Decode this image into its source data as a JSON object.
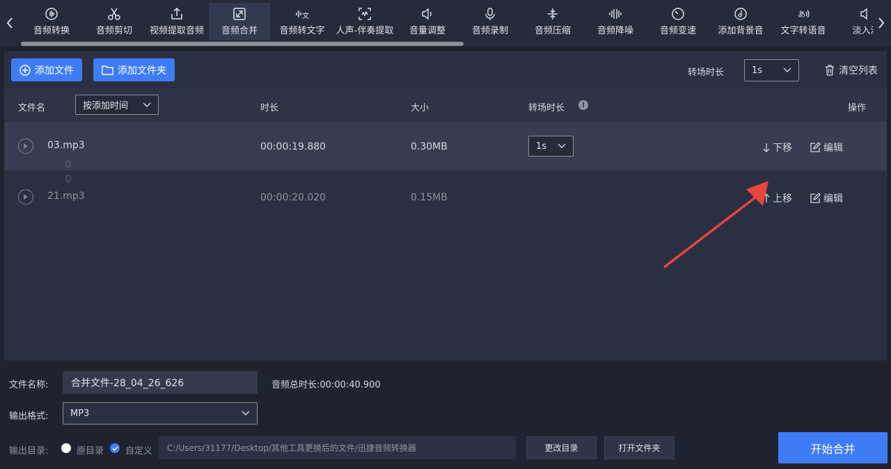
{
  "toolbar": {
    "prev_icon": "chevron-left-icon",
    "next_icon": "chevron-right-icon",
    "active_index": 3,
    "tools": [
      {
        "label": "音频转换",
        "icon": "waveform-circle-icon"
      },
      {
        "label": "音频剪切",
        "icon": "scissors-icon"
      },
      {
        "label": "视频提取音频",
        "icon": "upload-box-icon"
      },
      {
        "label": "音频合并",
        "icon": "merge-icon"
      },
      {
        "label": "音频转文字",
        "icon": "audio-text-icon"
      },
      {
        "label": "人声-伴奏提取",
        "icon": "voice-extract-icon"
      },
      {
        "label": "音量调整",
        "icon": "speaker-icon"
      },
      {
        "label": "音频录制",
        "icon": "microphone-icon"
      },
      {
        "label": "音频压缩",
        "icon": "compress-icon"
      },
      {
        "label": "音频降噪",
        "icon": "equalizer-icon"
      },
      {
        "label": "音频变速",
        "icon": "speed-dial-icon"
      },
      {
        "label": "添加背景音",
        "icon": "music-disc-icon"
      },
      {
        "label": "文字转语音",
        "icon": "text-speech-icon"
      },
      {
        "label": "淡入淡",
        "icon": "fade-icon"
      }
    ]
  },
  "actions": {
    "add_file": "添加文件",
    "add_folder": "添加文件夹",
    "transition_label": "转场时长",
    "transition_value": "1s",
    "clear_list": "清空列表"
  },
  "table": {
    "col_name": "文件名",
    "sort_value": "按添加时间",
    "col_duration": "时长",
    "col_size": "大小",
    "col_transition": "转场时长",
    "col_ops": "操作",
    "rows": [
      {
        "name": "03.mp3",
        "duration": "00:00:19.880",
        "size": "0.30MB",
        "transition": "1s",
        "move": "下移",
        "edit": "编辑",
        "selected": true
      },
      {
        "name": "21.mp3",
        "duration": "00:00:20.020",
        "size": "0.15MB",
        "transition": "",
        "move": "上移",
        "edit": "编辑",
        "selected": false
      }
    ]
  },
  "bottom": {
    "filename_label": "文件名称:",
    "filename_value": "合并文件-28_04_26_626",
    "total_label": "音频总时长:",
    "total_value": "00:00:40.900",
    "format_label": "输出格式:",
    "format_value": "MP3",
    "dir_label": "输出目录:",
    "opt_original": "原目录",
    "opt_custom": "自定义",
    "path": "C:/Users/31177/Desktop/其他工具更换后的文件/迅捷音频转换器",
    "change_dir": "更改目录",
    "open_folder": "打开文件夹",
    "start": "开始合并"
  },
  "colors": {
    "accent": "#3d7cf5",
    "annotation_arrow": "#e8453c"
  }
}
